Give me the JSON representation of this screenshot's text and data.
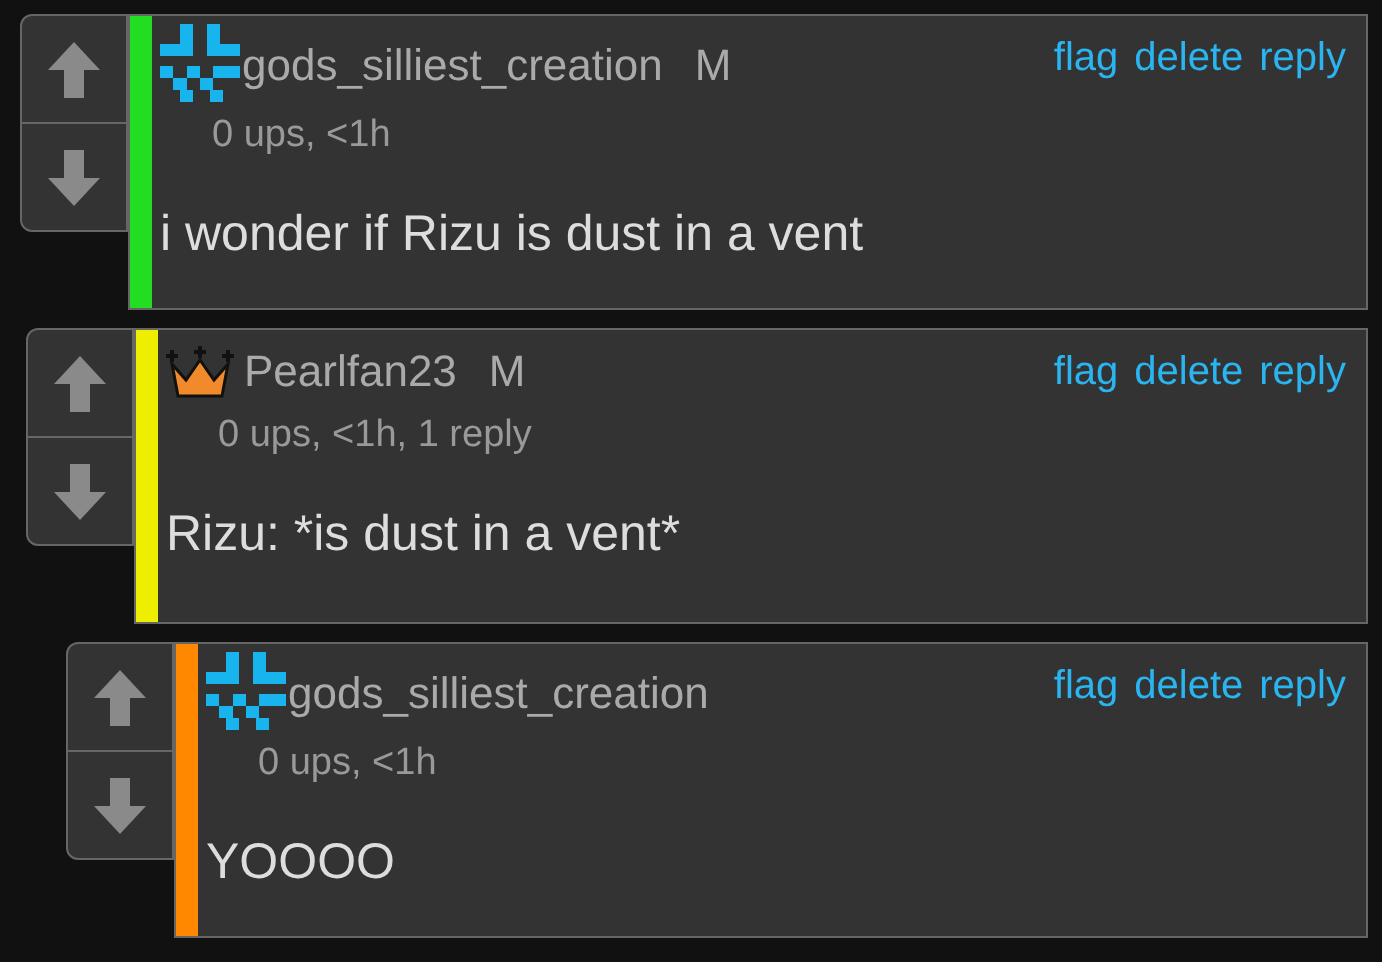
{
  "comments": [
    {
      "avatar": {
        "kind": "pixel"
      },
      "username": "gods_silliest_creation",
      "badge": "M",
      "meta": "0 ups, <1h",
      "actions": [
        "flag",
        "delete",
        "reply"
      ],
      "text": "i wonder if Rizu is dust in a vent",
      "color": "#22dd22"
    },
    {
      "avatar": {
        "kind": "crown"
      },
      "username": "Pearlfan23",
      "badge": "M",
      "meta": "0 ups, <1h, 1 reply",
      "actions": [
        "flag",
        "delete",
        "reply"
      ],
      "text": "Rizu: *is dust in a vent*",
      "color": "#eeee00"
    },
    {
      "avatar": {
        "kind": "pixel"
      },
      "username": "gods_silliest_creation",
      "meta": "0 ups, <1h",
      "actions": [
        "flag",
        "delete",
        "reply"
      ],
      "text": "YOOOO",
      "color": "#ff8800"
    }
  ]
}
